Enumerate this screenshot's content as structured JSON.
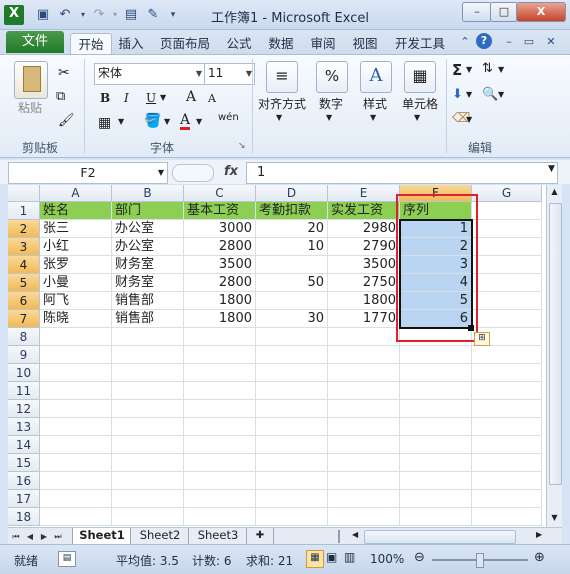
{
  "window": {
    "title": "工作簿1 - Microsoft Excel",
    "min_label": "–",
    "max_label": "□",
    "close_label": "X"
  },
  "qat": {
    "app_icon": "excel-icon",
    "save_icon": "save-icon",
    "undo_icon": "undo-icon",
    "redo_icon": "redo-icon",
    "print_preview_icon": "print-preview-icon",
    "customize_icon": "chevron-down-icon"
  },
  "tabs": {
    "file": "文件",
    "items": [
      "开始",
      "插入",
      "页面布局",
      "公式",
      "数据",
      "审阅",
      "视图",
      "开发工具"
    ],
    "active": "开始"
  },
  "ribbon": {
    "clipboard": {
      "paste": "粘贴",
      "group": "剪贴板"
    },
    "font": {
      "name": "宋体",
      "size": "11",
      "bold": "B",
      "italic": "I",
      "underline": "U",
      "grow": "A",
      "shrink": "A",
      "font_color": "A",
      "phonetic": "wén",
      "group": "字体"
    },
    "alignment": {
      "label": "对齐方式"
    },
    "number": {
      "label": "数字",
      "icon_text": "%"
    },
    "styles": {
      "label": "样式",
      "icon_text": "A"
    },
    "cells": {
      "label": "单元格"
    },
    "editing": {
      "group": "编辑",
      "sum": "Σ"
    }
  },
  "formula_bar": {
    "name_box": "F2",
    "fx": "fx",
    "value": "1"
  },
  "sheet": {
    "columns": [
      "A",
      "B",
      "C",
      "D",
      "E",
      "F",
      "G"
    ],
    "rows": [
      "1",
      "2",
      "3",
      "4",
      "5",
      "6",
      "7",
      "8",
      "9",
      "10",
      "11",
      "12",
      "13",
      "14",
      "15",
      "16",
      "17",
      "18"
    ],
    "header": [
      "姓名",
      "部门",
      "基本工资",
      "考勤扣款",
      "实发工资",
      "序列"
    ],
    "data": [
      [
        "张三",
        "办公室",
        "3000",
        "20",
        "2980",
        "1"
      ],
      [
        "小红",
        "办公室",
        "2800",
        "10",
        "2790",
        "2"
      ],
      [
        "张罗",
        "财务室",
        "3500",
        "",
        "3500",
        "3"
      ],
      [
        "小曼",
        "财务室",
        "2800",
        "50",
        "2750",
        "4"
      ],
      [
        "阿飞",
        "销售部",
        "1800",
        "",
        "1800",
        "5"
      ],
      [
        "陈晓",
        "销售部",
        "1800",
        "30",
        "1770",
        "6"
      ]
    ],
    "header_color": "#8ccf52",
    "selection_color": "#b9d5f2",
    "highlight_color": "#e0202a"
  },
  "sheet_tabs": [
    "Sheet1",
    "Sheet2",
    "Sheet3"
  ],
  "status": {
    "ready": "就绪",
    "average": "平均值: 3.5",
    "count": "计数: 6",
    "sum": "求和: 21",
    "zoom": "100%"
  }
}
